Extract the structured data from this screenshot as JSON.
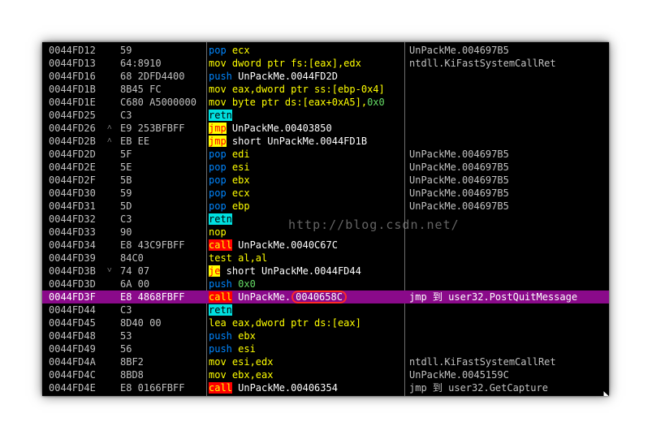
{
  "watermark": "http://blog.csdn.net/",
  "highlighted_address": "0040658C",
  "colors": {
    "selected_row": "#8a0a8a",
    "push_pop": "#0086ff",
    "mov": "#ffff00",
    "retn_bg": "#00e0e0",
    "jmp_bg": "#ffff00",
    "call_bg": "#ff0000"
  },
  "rows": [
    {
      "addr": "0044FD12",
      "mark": "",
      "hex": "59",
      "mn": "pop",
      "mc": "pop",
      "ops": [
        {
          "t": " ecx",
          "c": "y"
        }
      ],
      "cmt": "UnPackMe.004697B5"
    },
    {
      "addr": "0044FD13",
      "mark": "",
      "hex": "64:8910",
      "mn": "mov",
      "mc": "mov",
      "ops": [
        {
          "t": " dword ptr fs:[eax],edx",
          "c": "y"
        }
      ],
      "cmt": "ntdll.KiFastSystemCallRet"
    },
    {
      "addr": "0044FD16",
      "mark": "",
      "hex": "68 2DFD4400",
      "mn": "push",
      "mc": "push",
      "ops": [
        {
          "t": " UnPackMe.0044FD2D",
          "c": "w"
        }
      ],
      "cmt": ""
    },
    {
      "addr": "0044FD1B",
      "mark": "",
      "hex": "8B45 FC",
      "mn": "mov",
      "mc": "mov",
      "ops": [
        {
          "t": " eax,dword ptr ss:[ebp-0x4]",
          "c": "y"
        }
      ],
      "cmt": ""
    },
    {
      "addr": "0044FD1E",
      "mark": "",
      "hex": "C680 A5000000",
      "mn": "mov",
      "mc": "mov",
      "ops": [
        {
          "t": " byte ptr ds:[eax+0xA5],",
          "c": "y"
        },
        {
          "t": "0x0",
          "c": "g"
        }
      ],
      "cmt": ""
    },
    {
      "addr": "0044FD25",
      "mark": "",
      "hex": "C3",
      "mn": "retn",
      "mc": "retn",
      "ops": [],
      "cmt": ""
    },
    {
      "addr": "0044FD26",
      "mark": "^",
      "hex": "E9 253BFBFF",
      "mn": "jmp",
      "mc": "jmp",
      "ops": [
        {
          "t": " UnPackMe.00403850",
          "c": "w"
        }
      ],
      "cmt": ""
    },
    {
      "addr": "0044FD2B",
      "mark": "^",
      "hex": "EB EE",
      "mn": "jmp",
      "mc": "jmp",
      "ops": [
        {
          "t": " short UnPackMe.0044FD1B",
          "c": "w"
        }
      ],
      "cmt": ""
    },
    {
      "addr": "0044FD2D",
      "mark": "",
      "hex": "5F",
      "mn": "pop",
      "mc": "pop",
      "ops": [
        {
          "t": " edi",
          "c": "y"
        }
      ],
      "cmt": "UnPackMe.004697B5"
    },
    {
      "addr": "0044FD2E",
      "mark": "",
      "hex": "5E",
      "mn": "pop",
      "mc": "pop",
      "ops": [
        {
          "t": " esi",
          "c": "y"
        }
      ],
      "cmt": "UnPackMe.004697B5"
    },
    {
      "addr": "0044FD2F",
      "mark": "",
      "hex": "5B",
      "mn": "pop",
      "mc": "pop",
      "ops": [
        {
          "t": " ebx",
          "c": "y"
        }
      ],
      "cmt": "UnPackMe.004697B5"
    },
    {
      "addr": "0044FD30",
      "mark": "",
      "hex": "59",
      "mn": "pop",
      "mc": "pop",
      "ops": [
        {
          "t": " ecx",
          "c": "y"
        }
      ],
      "cmt": "UnPackMe.004697B5"
    },
    {
      "addr": "0044FD31",
      "mark": "",
      "hex": "5D",
      "mn": "pop",
      "mc": "pop",
      "ops": [
        {
          "t": " ebp",
          "c": "y"
        }
      ],
      "cmt": "UnPackMe.004697B5"
    },
    {
      "addr": "0044FD32",
      "mark": "",
      "hex": "C3",
      "mn": "retn",
      "mc": "retn",
      "ops": [],
      "cmt": ""
    },
    {
      "addr": "0044FD33",
      "mark": "",
      "hex": "90",
      "mn": "nop",
      "mc": "nop",
      "ops": [],
      "cmt": ""
    },
    {
      "addr": "0044FD34",
      "mark": "",
      "hex": "E8 43C9FBFF",
      "mn": "call",
      "mc": "call",
      "ops": [
        {
          "t": " UnPackMe.0040C67C",
          "c": "w"
        }
      ],
      "cmt": ""
    },
    {
      "addr": "0044FD39",
      "mark": "",
      "hex": "84C0",
      "mn": "test",
      "mc": "test",
      "ops": [
        {
          "t": " al,al",
          "c": "y"
        }
      ],
      "cmt": ""
    },
    {
      "addr": "0044FD3B",
      "mark": "v",
      "hex": "74 07",
      "mn": "je",
      "mc": "je",
      "ops": [
        {
          "t": " short UnPackMe.0044FD44",
          "c": "w"
        }
      ],
      "cmt": ""
    },
    {
      "addr": "0044FD3D",
      "mark": "",
      "hex": "6A 00",
      "mn": "push",
      "mc": "push",
      "ops": [
        {
          "t": " 0x0",
          "c": "g"
        }
      ],
      "cmt": ""
    },
    {
      "addr": "0044FD3F",
      "mark": "",
      "hex": "E8 4868FBFF",
      "mn": "call",
      "mc": "call",
      "ops": [
        {
          "t": " UnPackMe.",
          "c": "w"
        }
      ],
      "hl": "0040658C",
      "cmt": "jmp 到 user32.PostQuitMessage",
      "sel": true
    },
    {
      "addr": "0044FD44",
      "mark": "",
      "hex": "C3",
      "mn": "retn",
      "mc": "retn",
      "ops": [],
      "cmt": ""
    },
    {
      "addr": "0044FD45",
      "mark": "",
      "hex": "8D40 00",
      "mn": "lea",
      "mc": "lea",
      "ops": [
        {
          "t": " eax,dword ptr ds:[eax]",
          "c": "y"
        }
      ],
      "cmt": ""
    },
    {
      "addr": "0044FD48",
      "mark": "",
      "hex": "53",
      "mn": "push",
      "mc": "push",
      "ops": [
        {
          "t": " ebx",
          "c": "y"
        }
      ],
      "cmt": ""
    },
    {
      "addr": "0044FD49",
      "mark": "",
      "hex": "56",
      "mn": "push",
      "mc": "push",
      "ops": [
        {
          "t": " esi",
          "c": "y"
        }
      ],
      "cmt": ""
    },
    {
      "addr": "0044FD4A",
      "mark": "",
      "hex": "8BF2",
      "mn": "mov",
      "mc": "mov",
      "ops": [
        {
          "t": " esi,edx",
          "c": "y"
        }
      ],
      "cmt": "ntdll.KiFastSystemCallRet"
    },
    {
      "addr": "0044FD4C",
      "mark": "",
      "hex": "8BD8",
      "mn": "mov",
      "mc": "mov",
      "ops": [
        {
          "t": " ebx,eax",
          "c": "y"
        }
      ],
      "cmt": "UnPackMe.0045159C"
    },
    {
      "addr": "0044FD4E",
      "mark": "",
      "hex": "E8 0166FBFF",
      "mn": "call",
      "mc": "call",
      "ops": [
        {
          "t": " UnPackMe.00406354",
          "c": "w"
        }
      ],
      "cmt": "jmp 到 user32.GetCapture"
    }
  ]
}
